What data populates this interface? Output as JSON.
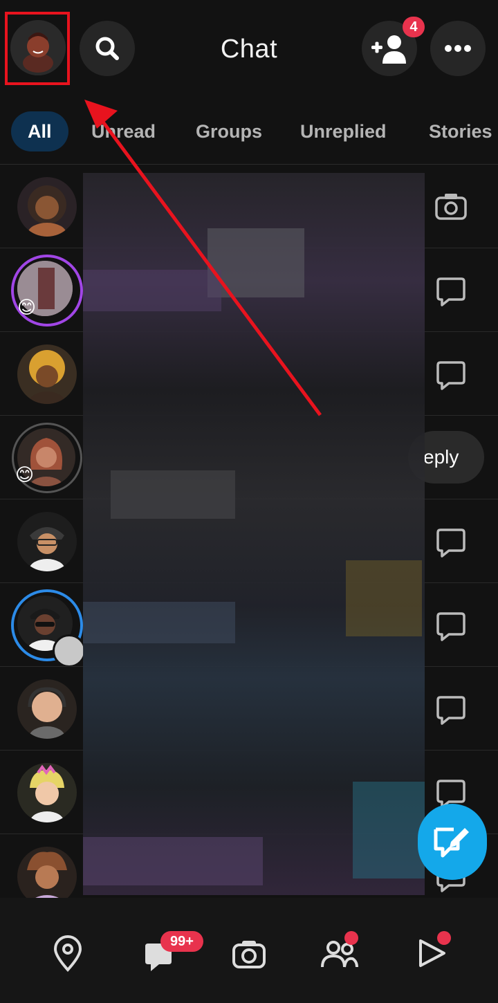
{
  "header": {
    "title": "Chat",
    "add_friend_badge": "4"
  },
  "tabs": [
    {
      "label": "All",
      "active": true
    },
    {
      "label": "Unread",
      "active": false
    },
    {
      "label": "Groups",
      "active": false
    },
    {
      "label": "Unreplied",
      "active": false
    },
    {
      "label": "Stories",
      "active": false
    }
  ],
  "rows": [
    {
      "icon": "camera-icon",
      "reply_label": ""
    },
    {
      "icon": "chat-bubble-icon",
      "emoji": "😊"
    },
    {
      "icon": "chat-bubble-icon"
    },
    {
      "icon": "",
      "emoji": "😊",
      "reply_label": "eply"
    },
    {
      "icon": "chat-bubble-icon"
    },
    {
      "icon": "chat-bubble-icon"
    },
    {
      "icon": "chat-bubble-icon"
    },
    {
      "icon": "chat-bubble-icon"
    },
    {
      "icon": "chat-bubble-icon"
    }
  ],
  "bottom_nav": {
    "chat_badge": "99+"
  },
  "colors": {
    "background": "#121212",
    "accent_blue": "#14a8ea",
    "badge_red": "#e8334d",
    "annotation_red": "#e8131e",
    "story_ring_purple": "#a146e6",
    "story_ring_blue": "#2c8be8"
  }
}
